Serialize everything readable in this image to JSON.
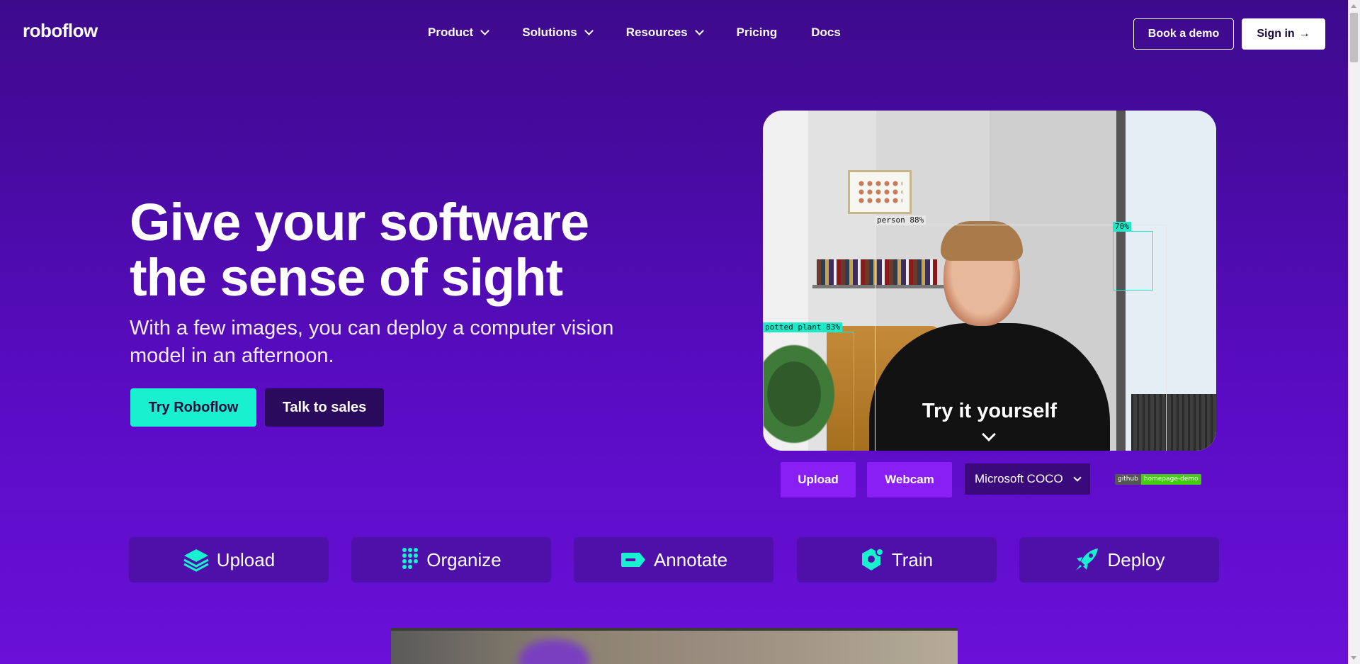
{
  "nav": {
    "logo": "roboflow",
    "links": [
      {
        "label": "Product",
        "dropdown": true
      },
      {
        "label": "Solutions",
        "dropdown": true
      },
      {
        "label": "Resources",
        "dropdown": true
      },
      {
        "label": "Pricing",
        "dropdown": false
      },
      {
        "label": "Docs",
        "dropdown": false
      }
    ],
    "book_demo": "Book a demo",
    "sign_in": "Sign in",
    "sign_in_arrow": "→"
  },
  "hero": {
    "title": "Give your software the sense of sight",
    "subtitle": "With a few images, you can deploy a computer vision model in an afternoon.",
    "try_button": "Try Roboflow",
    "sales_button": "Talk to sales"
  },
  "demo": {
    "detections": [
      {
        "label": "person 88%",
        "color": "#e6e6e6"
      },
      {
        "label": "potted plant 83%",
        "color": "#1de9c8"
      },
      {
        "label": "70%",
        "color": "#1de9c8"
      }
    ],
    "overlay_text": "Try it yourself",
    "controls": {
      "upload": "Upload",
      "webcam": "Webcam",
      "model_select": "Microsoft COCO"
    },
    "badge": {
      "left": "github",
      "right": "homepage-demo"
    }
  },
  "features": [
    {
      "label": "Upload",
      "icon": "layers-icon"
    },
    {
      "label": "Organize",
      "icon": "grid-dots-icon"
    },
    {
      "label": "Annotate",
      "icon": "tag-icon"
    },
    {
      "label": "Train",
      "icon": "hexagon-icon"
    },
    {
      "label": "Deploy",
      "icon": "rocket-icon"
    }
  ],
  "colors": {
    "accent_teal": "#18f0d0",
    "accent_purple": "#8a1ff5",
    "bg_top": "#3d0a8c",
    "bg_bottom": "#6a10d8"
  }
}
